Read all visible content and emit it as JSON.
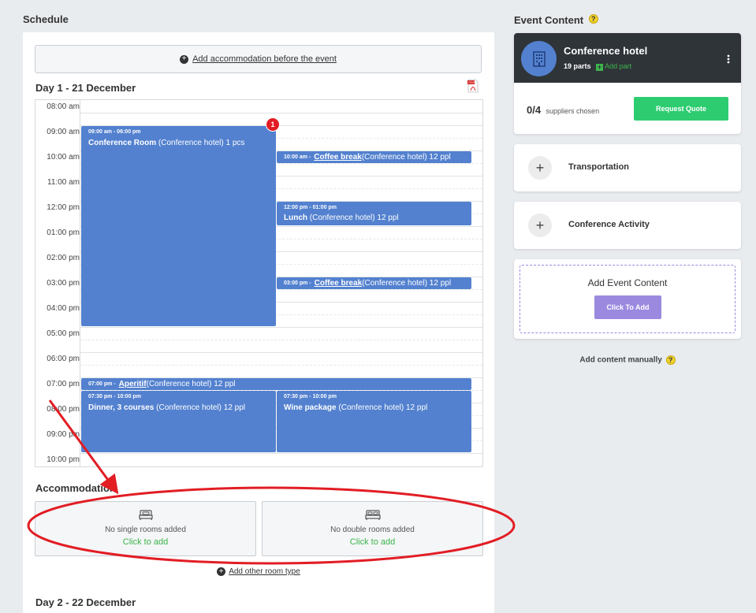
{
  "schedule": {
    "title": "Schedule",
    "add_before_label": "Add accommodation before the event",
    "day1": {
      "heading": "Day 1 - 21 December",
      "times": [
        "08:00 am",
        "09:00 am",
        "10:00 am",
        "11:00 am",
        "12:00 pm",
        "01:00 pm",
        "02:00 pm",
        "03:00 pm",
        "04:00 pm",
        "05:00 pm",
        "06:00 pm",
        "07:00 pm",
        "08:00 pm",
        "09:00 pm",
        "10:00 pm"
      ],
      "badge": "1",
      "events": [
        {
          "time": "09:00 am - 06:00 pm",
          "name": "Conference Room",
          "detail": " (Conference hotel) 1 pcs"
        },
        {
          "time": "10:00 am -",
          "name": "Coffee break",
          "detail": " (Conference hotel) 12 ppl"
        },
        {
          "time": "12:00 pm - 01:00 pm",
          "name": "Lunch",
          "detail": " (Conference hotel) 12 ppl"
        },
        {
          "time": "03:00 pm -",
          "name": "Coffee break",
          "detail": " (Conference hotel) 12 ppl"
        },
        {
          "time": "07:00 pm -",
          "name": "Aperitif",
          "detail": " (Conference hotel) 12 ppl"
        },
        {
          "time": "07:30 pm - 10:00 pm",
          "name": "Dinner, 3 courses",
          "detail": " (Conference hotel) 12 ppl"
        },
        {
          "time": "07:30 pm - 10:00 pm",
          "name": "Wine package",
          "detail": " (Conference hotel) 12 ppl"
        }
      ]
    },
    "accommodation": {
      "heading": "Accommodation",
      "single_text": "No single rooms added",
      "double_text": "No double rooms added",
      "click_to_add": "Click to add",
      "other_room": "Add other room type"
    },
    "day2": {
      "heading": "Day 2 - 22 December"
    }
  },
  "event_content": {
    "title": "Event Content",
    "hotel": {
      "name": "Conference hotel",
      "parts": "19 parts",
      "add_part": "Add part"
    },
    "suppliers": {
      "count": "0/4",
      "label": "suppliers chosen"
    },
    "request_quote": "Request Quote",
    "items": [
      "Transportation",
      "Conference Activity"
    ],
    "add_event_content": "Add Event Content",
    "click_to_add": "Click To Add",
    "add_manually": "Add content manually"
  },
  "colors": {
    "event_blue": "#5381cf",
    "quote_green": "#2ecc71",
    "click_purple": "#9b89e0",
    "annotation_red": "#e21d24"
  }
}
